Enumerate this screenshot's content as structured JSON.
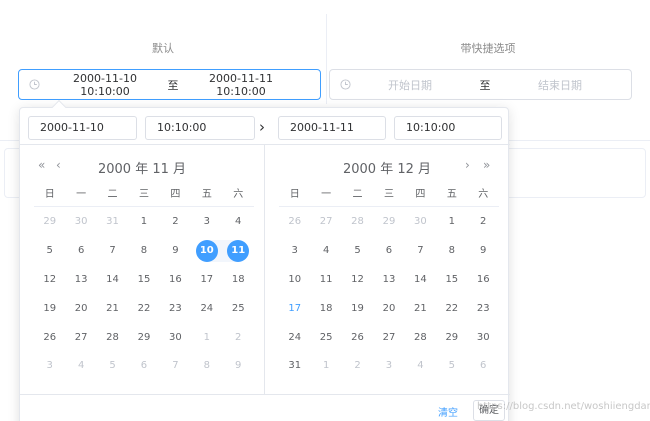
{
  "sections": {
    "default_title": "默认",
    "shortcuts_title": "带快捷选项"
  },
  "default_range": {
    "start_value": "2000-11-10 10:10:00",
    "separator": "至",
    "end_value": "2000-11-11 10:10:00"
  },
  "shortcut_range": {
    "start_placeholder": "开始日期",
    "separator": "至",
    "end_placeholder": "结束日期"
  },
  "picker": {
    "start_date": "2000-11-10",
    "start_time": "10:10:00",
    "end_date": "2000-11-11",
    "end_time": "10:10:00",
    "range_arrow": "›",
    "weekdays": [
      "日",
      "一",
      "二",
      "三",
      "四",
      "五",
      "六"
    ],
    "nav": {
      "prev_year": "«",
      "prev_month": "‹",
      "next_month": "›",
      "next_year": "»"
    },
    "left": {
      "title": "2000 年 11 月",
      "days": [
        [
          {
            "d": "29",
            "t": "prev"
          },
          {
            "d": "30",
            "t": "prev"
          },
          {
            "d": "31",
            "t": "prev"
          },
          {
            "d": "1"
          },
          {
            "d": "2"
          },
          {
            "d": "3"
          },
          {
            "d": "4"
          }
        ],
        [
          {
            "d": "5"
          },
          {
            "d": "6"
          },
          {
            "d": "7"
          },
          {
            "d": "8"
          },
          {
            "d": "9"
          },
          {
            "d": "10",
            "s": "start"
          },
          {
            "d": "11",
            "s": "end"
          }
        ],
        [
          {
            "d": "12"
          },
          {
            "d": "13"
          },
          {
            "d": "14"
          },
          {
            "d": "15"
          },
          {
            "d": "16"
          },
          {
            "d": "17"
          },
          {
            "d": "18"
          }
        ],
        [
          {
            "d": "19"
          },
          {
            "d": "20"
          },
          {
            "d": "21"
          },
          {
            "d": "22"
          },
          {
            "d": "23"
          },
          {
            "d": "24"
          },
          {
            "d": "25"
          }
        ],
        [
          {
            "d": "26"
          },
          {
            "d": "27"
          },
          {
            "d": "28"
          },
          {
            "d": "29"
          },
          {
            "d": "30"
          },
          {
            "d": "1",
            "t": "next"
          },
          {
            "d": "2",
            "t": "next"
          }
        ],
        [
          {
            "d": "3",
            "t": "next"
          },
          {
            "d": "4",
            "t": "next"
          },
          {
            "d": "5",
            "t": "next"
          },
          {
            "d": "6",
            "t": "next"
          },
          {
            "d": "7",
            "t": "next"
          },
          {
            "d": "8",
            "t": "next"
          },
          {
            "d": "9",
            "t": "next"
          }
        ]
      ]
    },
    "right": {
      "title": "2000 年 12 月",
      "days": [
        [
          {
            "d": "26",
            "t": "prev"
          },
          {
            "d": "27",
            "t": "prev"
          },
          {
            "d": "28",
            "t": "prev"
          },
          {
            "d": "29",
            "t": "prev"
          },
          {
            "d": "30",
            "t": "prev"
          },
          {
            "d": "1"
          },
          {
            "d": "2"
          }
        ],
        [
          {
            "d": "3"
          },
          {
            "d": "4"
          },
          {
            "d": "5"
          },
          {
            "d": "6"
          },
          {
            "d": "7"
          },
          {
            "d": "8"
          },
          {
            "d": "9"
          }
        ],
        [
          {
            "d": "10"
          },
          {
            "d": "11"
          },
          {
            "d": "12"
          },
          {
            "d": "13"
          },
          {
            "d": "14"
          },
          {
            "d": "15"
          },
          {
            "d": "16"
          }
        ],
        [
          {
            "d": "17",
            "s": "today"
          },
          {
            "d": "18"
          },
          {
            "d": "19"
          },
          {
            "d": "20"
          },
          {
            "d": "21"
          },
          {
            "d": "22"
          },
          {
            "d": "23"
          }
        ],
        [
          {
            "d": "24"
          },
          {
            "d": "25"
          },
          {
            "d": "26"
          },
          {
            "d": "27"
          },
          {
            "d": "28"
          },
          {
            "d": "29"
          },
          {
            "d": "30"
          }
        ],
        [
          {
            "d": "31"
          },
          {
            "d": "1",
            "t": "next"
          },
          {
            "d": "2",
            "t": "next"
          },
          {
            "d": "3",
            "t": "next"
          },
          {
            "d": "4",
            "t": "next"
          },
          {
            "d": "5",
            "t": "next"
          },
          {
            "d": "6",
            "t": "next"
          }
        ]
      ]
    },
    "footer": {
      "clear_label": "清空",
      "ok_label": "确定"
    }
  },
  "watermark": "https://blog.csdn.net/woshiiengdanya",
  "colors": {
    "accent": "#409eff",
    "range_bg": "#f2f6fc",
    "muted": "#c0c4cc"
  },
  "icons": {
    "input_prefix": "clock-icon"
  }
}
